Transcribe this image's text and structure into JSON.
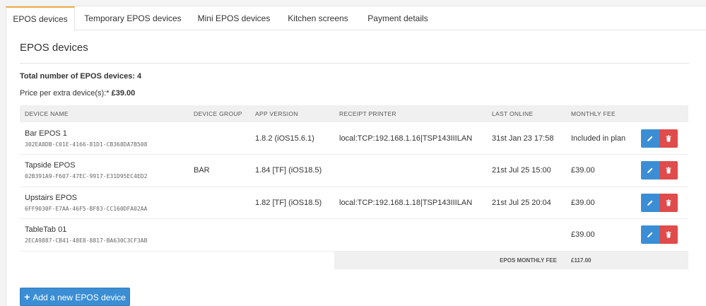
{
  "tabs": [
    {
      "label": "EPOS devices"
    },
    {
      "label": "Temporary EPOS devices"
    },
    {
      "label": "Mini EPOS devices"
    },
    {
      "label": "Kitchen screens"
    },
    {
      "label": "Payment details"
    }
  ],
  "section": {
    "title": "EPOS devices",
    "total_text": "Total number of EPOS devices: 4",
    "price_label": "Price per extra device(s):*",
    "price_value": "£39.00"
  },
  "table": {
    "headers": [
      "DEVICE NAME",
      "DEVICE GROUP",
      "APP VERSION",
      "RECEIPT PRINTER",
      "LAST ONLINE",
      "MONTHLY FEE"
    ],
    "rows": [
      {
        "name": "Bar EPOS 1",
        "id": "302EA8DB-C01E-4166-81D1-CB368DA7B508",
        "group": "",
        "version": "1.8.2 (iOS15.6.1)",
        "printer": "local:TCP:192.168.1.16|TSP143IIILAN",
        "last_online": "31st Jan 23 17:58",
        "fee": "Included in plan"
      },
      {
        "name": "Tapside EPOS",
        "id": "02B391A9-F607-47EC-9917-E31D95EC4ED2",
        "group": "BAR",
        "version": "1.84 [TF] (iOS18.5)",
        "printer": "",
        "last_online": "21st Jul 25 15:00",
        "fee": "£39.00"
      },
      {
        "name": "Upstairs EPOS",
        "id": "6FF9030F-E7AA-46F5-BF83-CC160DFA02AA",
        "group": "",
        "version": "1.82 [TF] (iOS18.5)",
        "printer": "local:TCP:192.168.1.18|TSP143IIILAN",
        "last_online": "21st Jul 25 20:04",
        "fee": "£39.00"
      },
      {
        "name": "TableTab 01",
        "id": "2ECA9887-CB41-48E8-8817-BA630C3CF3AB",
        "group": "",
        "version": "",
        "printer": "",
        "last_online": "",
        "fee": "£39.00"
      }
    ],
    "monthly_fee_label": "EPOS MONTHLY FEE",
    "monthly_fee_value": "£117.00"
  },
  "add_button": {
    "label": "Add a new EPOS device"
  },
  "colors": {
    "primary": "#3b8ed4",
    "danger": "#e04b4b",
    "tab_accent": "#f0ad4e"
  }
}
